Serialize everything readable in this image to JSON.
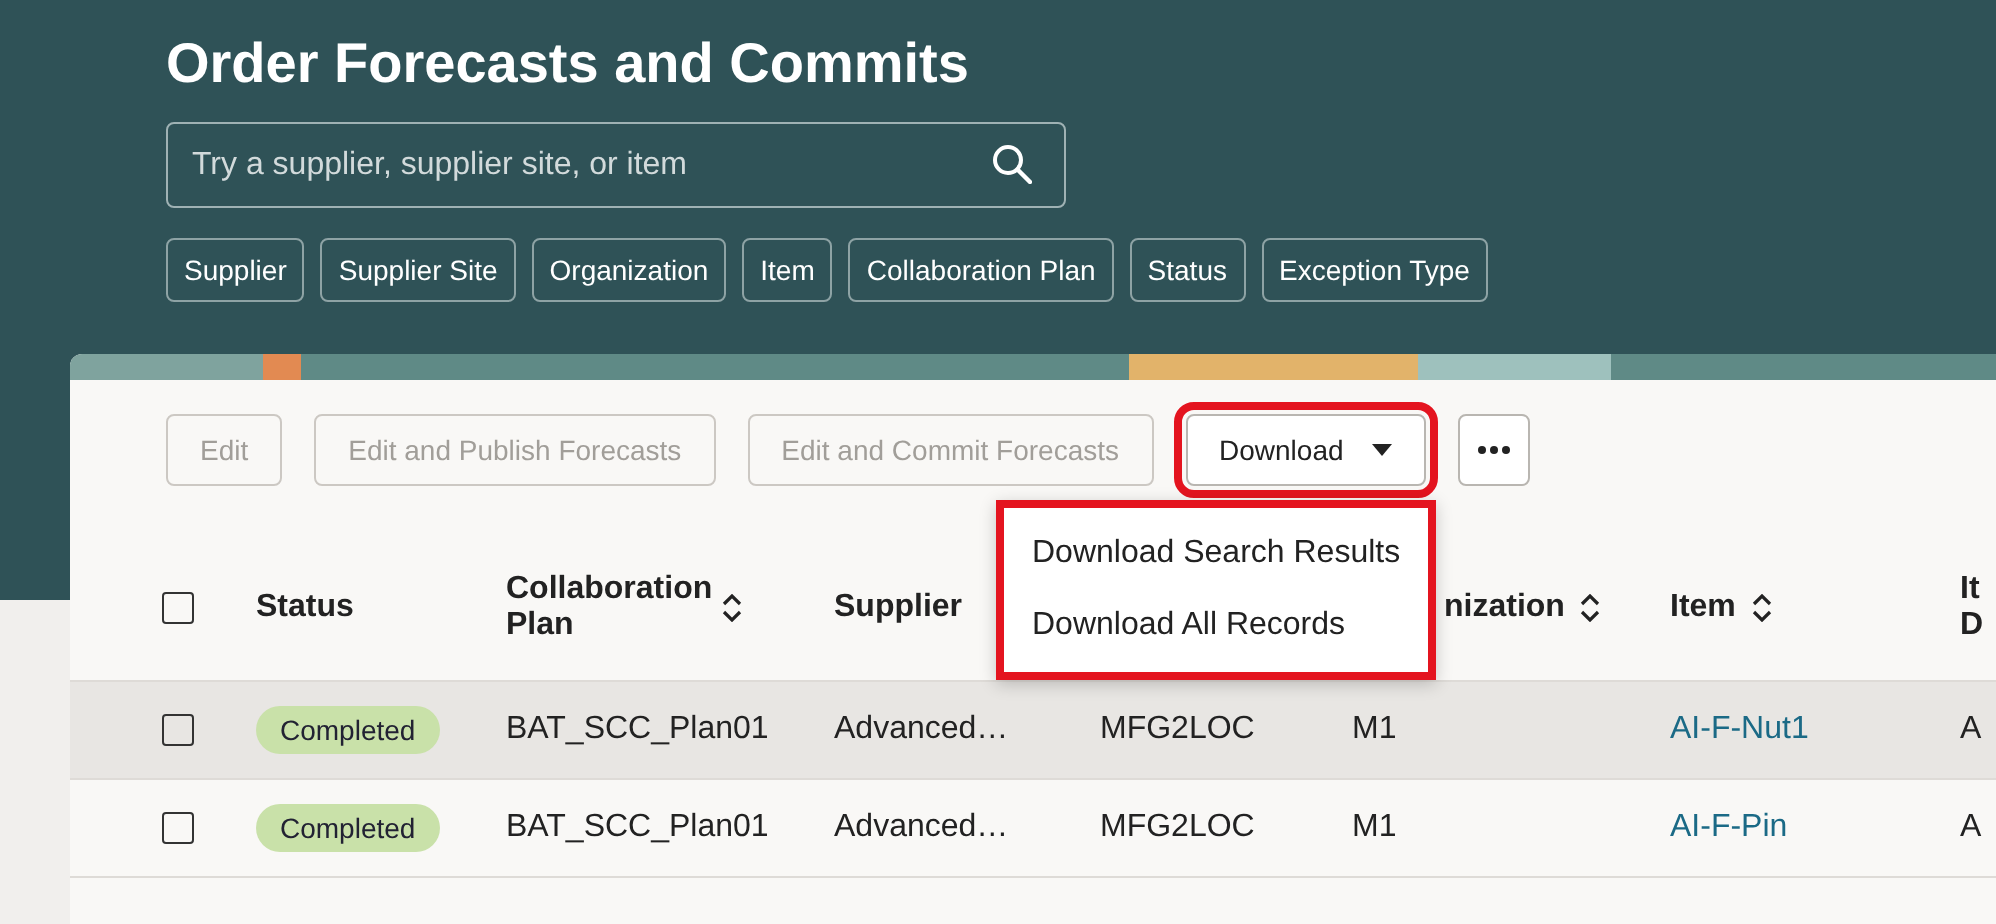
{
  "page": {
    "title": "Order Forecasts and Commits"
  },
  "search": {
    "placeholder": "Try a supplier, supplier site, or item"
  },
  "filters": [
    "Supplier",
    "Supplier Site",
    "Organization",
    "Item",
    "Collaboration Plan",
    "Status",
    "Exception Type"
  ],
  "toolbar": {
    "buttons": [
      {
        "label": "Edit",
        "kind": "plain",
        "disabled": true,
        "highlighted": false
      },
      {
        "label": "Edit and Publish Forecasts",
        "kind": "plain",
        "disabled": true,
        "highlighted": false
      },
      {
        "label": "Edit and Commit Forecasts",
        "kind": "plain",
        "disabled": true,
        "highlighted": false
      },
      {
        "label": "Download",
        "kind": "menu",
        "disabled": false,
        "highlighted": true
      },
      {
        "kind": "more",
        "disabled": false,
        "highlighted": false
      }
    ]
  },
  "menu": {
    "highlighted": true,
    "items": [
      "Download Search Results",
      "Download All Records"
    ]
  },
  "table": {
    "select_all": {
      "checked": false
    },
    "columns": [
      {
        "kind": "status",
        "label": "Status"
      },
      {
        "kind": "text",
        "label": "Collaboration Plan",
        "sortable": true
      },
      {
        "kind": "text",
        "label": "Supplier"
      },
      {
        "kind": "text"
      },
      {
        "kind": "text",
        "label": "nization",
        "sortable": true
      },
      {
        "kind": "link",
        "label": "Item",
        "sortable": true
      },
      {
        "kind": "text",
        "label": "It D"
      }
    ],
    "rows": [
      {
        "selected": true,
        "checked": false,
        "cells": [
          "Completed",
          "BAT_SCC_Plan01",
          "Advanced…",
          "MFG2LOC",
          "M1",
          "AI-F-Nut1",
          "A"
        ]
      },
      {
        "selected": false,
        "checked": false,
        "cells": [
          "Completed",
          "BAT_SCC_Plan01",
          "Advanced…",
          "MFG2LOC",
          "M1",
          "AI-F-Pin",
          "A"
        ]
      }
    ]
  }
}
